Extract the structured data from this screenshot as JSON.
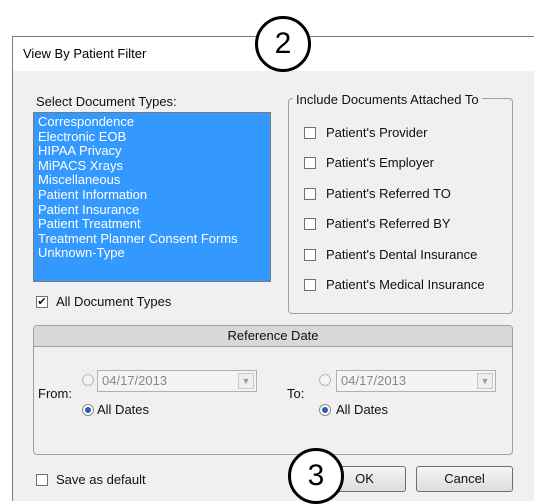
{
  "window": {
    "title": "View By Patient Filter"
  },
  "callouts": [
    "2",
    "3"
  ],
  "doc_types": {
    "label": "Select Document Types:",
    "items": [
      "Correspondence",
      "Electronic EOB",
      "HIPAA Privacy",
      "MiPACS Xrays",
      "Miscellaneous",
      "Patient Information",
      "Patient Insurance",
      "Patient Treatment",
      "Treatment Planner Consent Forms",
      "Unknown-Type"
    ],
    "all_label": "All Document Types",
    "all_checked": true
  },
  "attached": {
    "legend": "Include Documents Attached To",
    "options": [
      "Patient's Provider",
      "Patient's Employer",
      "Patient's Referred TO",
      "Patient's Referred BY",
      "Patient's Dental Insurance",
      "Patient's Medical Insurance"
    ]
  },
  "reference_date": {
    "header": "Reference Date",
    "from_label": "From:",
    "to_label": "To:",
    "from_date": "04/17/2013",
    "to_date": "04/17/2013",
    "all_dates_label": "All Dates"
  },
  "footer": {
    "save_default_label": "Save as default",
    "ok_label": "OK",
    "cancel_label": "Cancel"
  },
  "colors": {
    "selection": "#3399ff",
    "dialog_bg": "#f0f0f0"
  }
}
